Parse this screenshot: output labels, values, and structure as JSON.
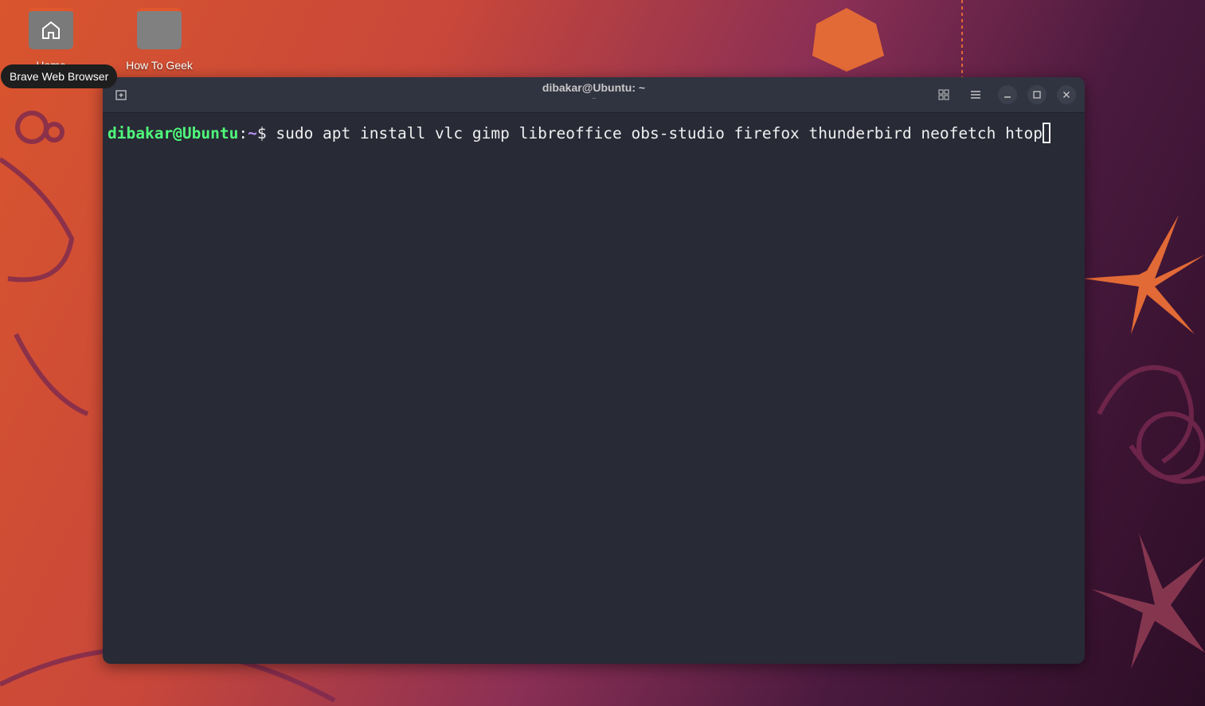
{
  "desktop": {
    "icons": [
      {
        "label": "Home",
        "icon": "home-icon"
      },
      {
        "label": "How To Geek",
        "icon": "folder-icon"
      }
    ],
    "tooltip": "Brave Web Browser"
  },
  "terminal": {
    "title": "dibakar@Ubuntu: ~",
    "subtitle": "~",
    "prompt_user": "dibakar@Ubuntu",
    "prompt_sep": ":",
    "prompt_path": "~",
    "prompt_symbol": "$ ",
    "command": "sudo apt install vlc gimp libreoffice obs-studio firefox thunderbird neofetch htop"
  },
  "colors": {
    "accent": "#e0572c",
    "prompt_user": "#50fa7b",
    "terminal_bg": "#282a36"
  }
}
